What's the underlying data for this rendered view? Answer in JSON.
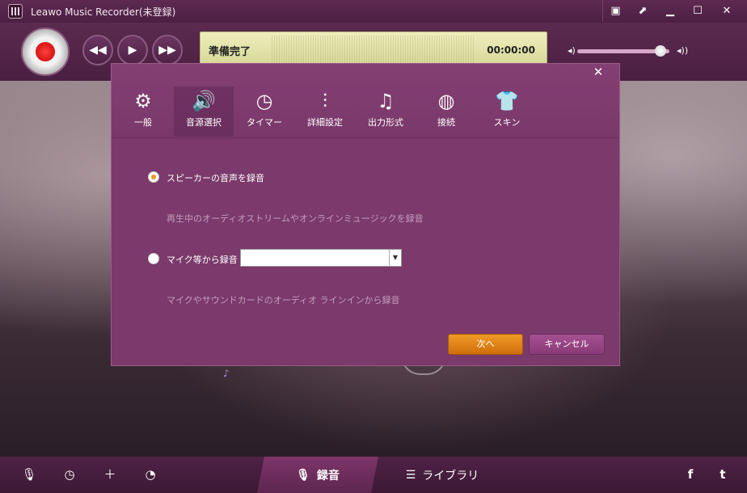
{
  "window": {
    "title": "Leawo Music Recorder(未登録)",
    "controls": [
      "menu-icon",
      "expand-icon",
      "minimize-icon",
      "maximize-icon",
      "close-icon"
    ]
  },
  "player": {
    "status": "準備完了",
    "time": "00:00:00",
    "volume_level": 0.9
  },
  "dialog": {
    "tabs": [
      {
        "label": "一般",
        "icon": "gear-icon",
        "glyph": "⚙"
      },
      {
        "label": "音源選択",
        "icon": "speaker-icon",
        "glyph": "🔊"
      },
      {
        "label": "タイマー",
        "icon": "clock-icon",
        "glyph": "◷"
      },
      {
        "label": "詳細設定",
        "icon": "sliders-icon",
        "glyph": "⫶"
      },
      {
        "label": "出力形式",
        "icon": "music-file-icon",
        "glyph": "♫"
      },
      {
        "label": "接続",
        "icon": "globe-icon",
        "glyph": "◍"
      },
      {
        "label": "スキン",
        "icon": "shirt-icon",
        "glyph": "👕"
      }
    ],
    "active_tab": 1,
    "options": {
      "speaker_label": "スピーカーの音声を録音",
      "speaker_desc": "再生中のオーディオストリームやオンラインミュージックを録音",
      "mic_label": "マイク等から録音",
      "mic_desc": "マイクやサウンドカードのオーディオ ラインインから録音",
      "mic_select_value": ""
    },
    "buttons": {
      "next": "次へ",
      "cancel": "キャンセル"
    }
  },
  "bottom": {
    "record_tab": "録音",
    "library_tab": "ライブラリ"
  },
  "colors": {
    "accent": "#e29b1f",
    "theme": "#7b3a6b"
  }
}
